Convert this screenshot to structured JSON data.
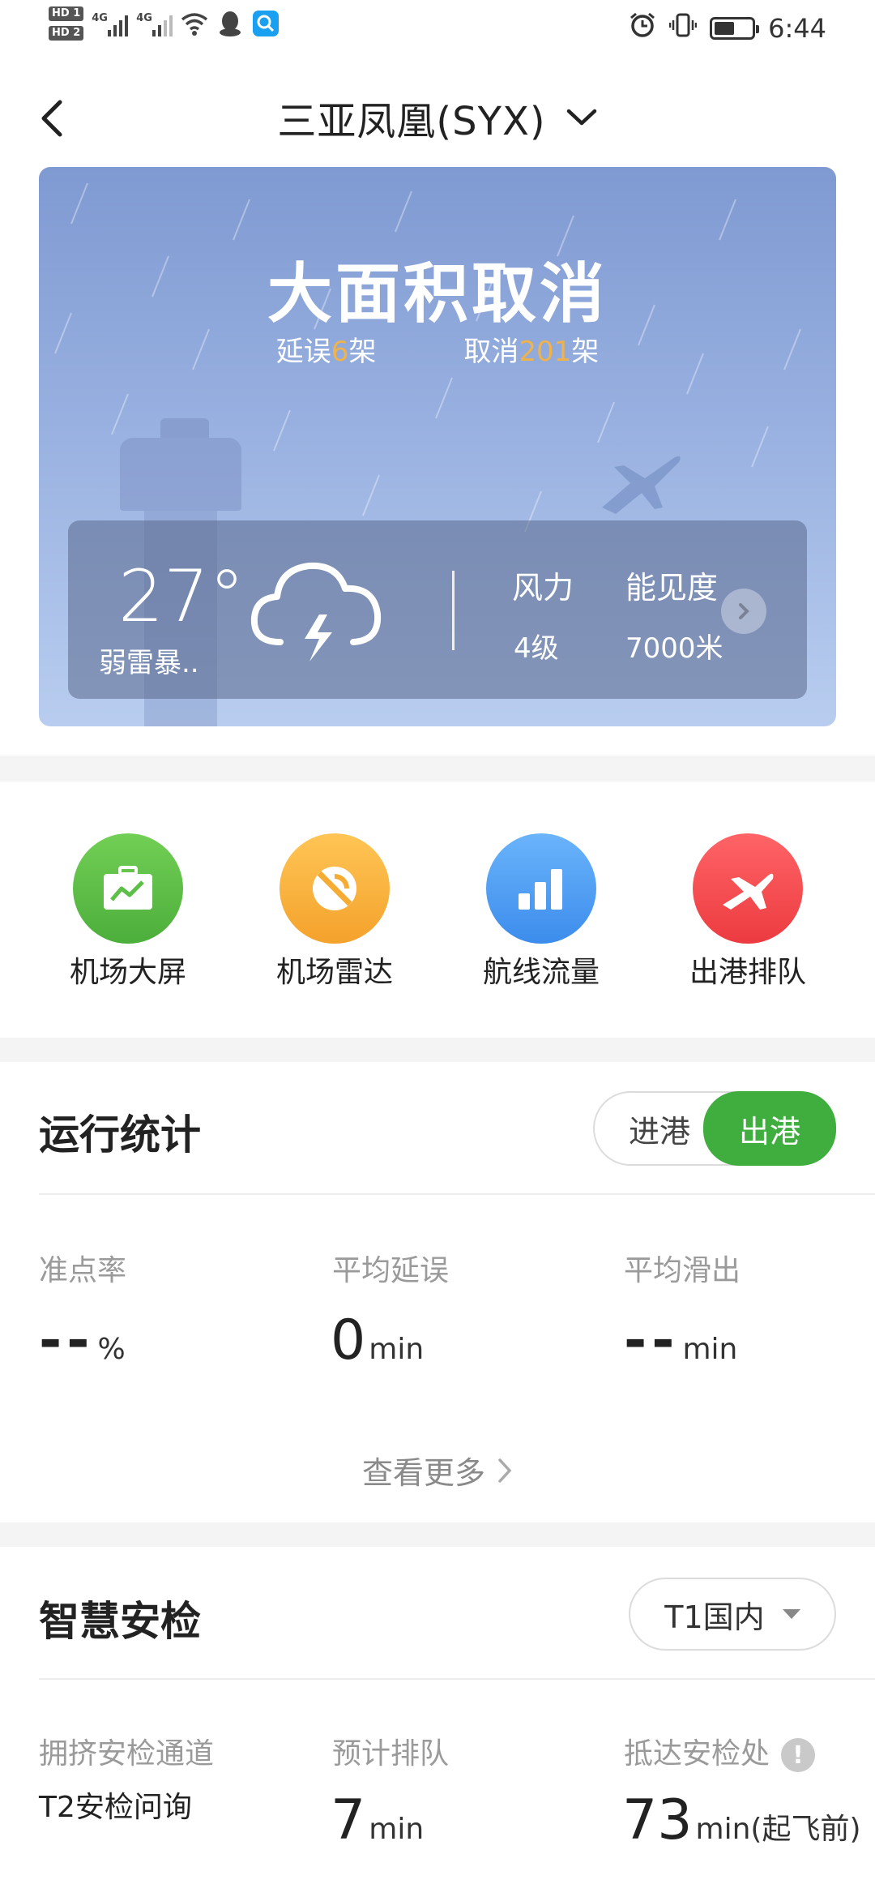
{
  "status_bar": {
    "hd1": "HD 1",
    "hd2": "HD 2",
    "net1": "4G",
    "net2": "4G",
    "time": "6:44",
    "battery_level": 0.55
  },
  "header": {
    "title": "三亚凤凰(SYX)"
  },
  "hero": {
    "status": "大面积取消",
    "delay_prefix": "延误",
    "delay_count": "6",
    "delay_suffix": "架",
    "cancel_prefix": "取消",
    "cancel_count": "201",
    "cancel_suffix": "架",
    "weather": {
      "temperature": "27°",
      "condition": "弱雷暴..",
      "wind_label": "风力",
      "wind_value": "4级",
      "visibility_label": "能见度",
      "visibility_value": "7000米"
    }
  },
  "quick_actions": [
    {
      "label": "机场大屏",
      "color": "#5cbf47",
      "icon": "briefcase-chart-icon"
    },
    {
      "label": "机场雷达",
      "color": "#f9b23a",
      "icon": "radar-icon"
    },
    {
      "label": "航线流量",
      "color": "#4a9bf0",
      "icon": "bar-chart-icon"
    },
    {
      "label": "出港排队",
      "color": "#f2474b",
      "icon": "plane-icon"
    }
  ],
  "ops_stats": {
    "title": "运行统计",
    "toggle": {
      "inbound": "进港",
      "outbound": "出港",
      "selected": "出港"
    },
    "on_time_label": "准点率",
    "on_time_value": "--",
    "on_time_unit": "%",
    "avg_delay_label": "平均延误",
    "avg_delay_value": "0",
    "avg_delay_unit": "min",
    "avg_taxi_label": "平均滑出",
    "avg_taxi_value": "--",
    "avg_taxi_unit": "min",
    "see_more": "查看更多"
  },
  "security": {
    "title": "智慧安检",
    "terminal": "T1国内",
    "crowded_label": "拥挤安检通道",
    "crowded_value": "T2安检问询",
    "queue_label": "预计排队",
    "queue_value": "7",
    "queue_unit": "min",
    "arrive_label": "抵达安检处",
    "arrive_value": "73",
    "arrive_unit": "min(起飞前)"
  },
  "colors": {
    "accent_green": "#3fae3f",
    "highlight_orange": "#f0b24a"
  }
}
